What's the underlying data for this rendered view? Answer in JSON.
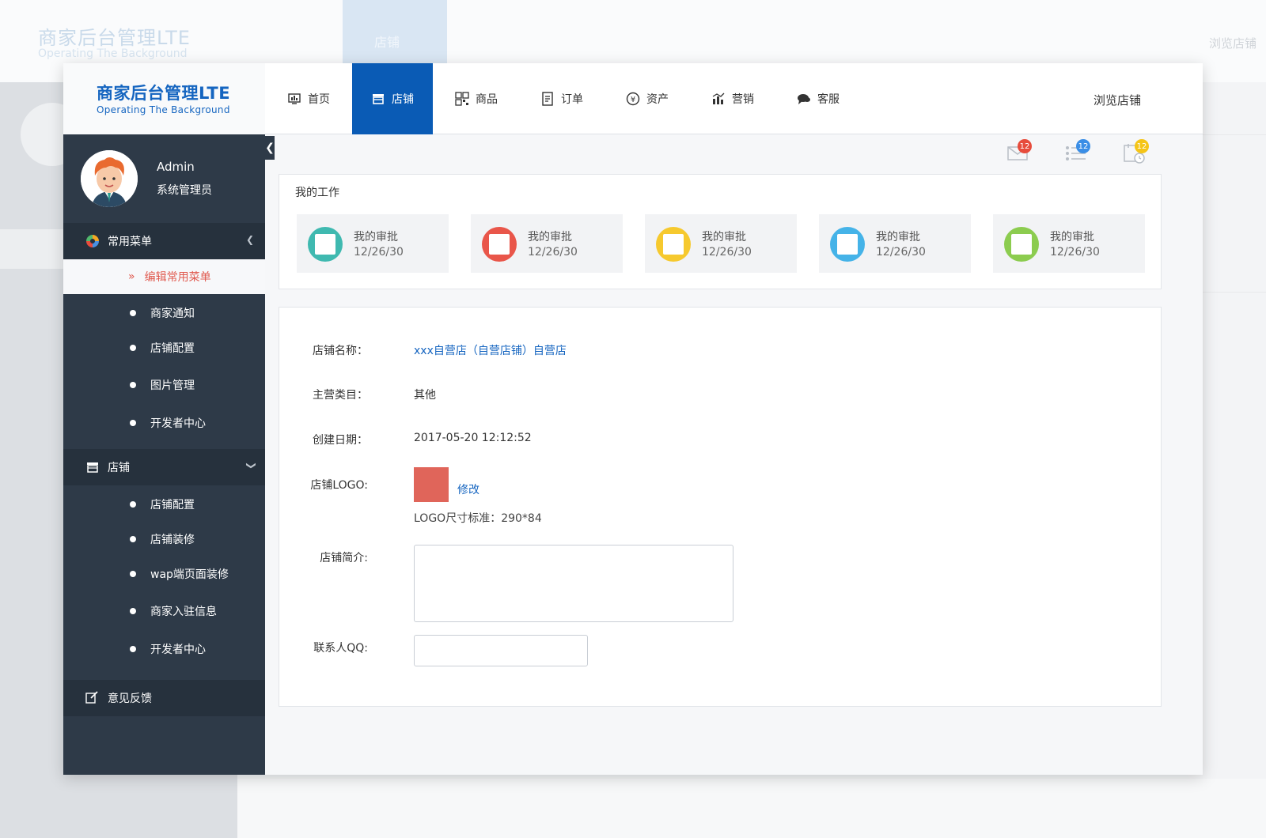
{
  "app": {
    "title": "商家后台管理LTE",
    "subtitle": "Operating The Background"
  },
  "nav": {
    "items": [
      {
        "label": "首页",
        "icon": "dashboard-icon"
      },
      {
        "label": "店铺",
        "icon": "store-icon",
        "active": true
      },
      {
        "label": "商品",
        "icon": "grid-icon"
      },
      {
        "label": "订单",
        "icon": "document-icon"
      },
      {
        "label": "资产",
        "icon": "yen-icon"
      },
      {
        "label": "营销",
        "icon": "bar-chart-icon"
      },
      {
        "label": "客服",
        "icon": "chat-icon"
      }
    ],
    "browse_label": "浏览店铺"
  },
  "user": {
    "name": "Admin",
    "role": "系统管理员"
  },
  "sidebar": {
    "common_menu": {
      "label": "常用菜单",
      "edit_label": "编辑常用菜单",
      "items": [
        "商家通知",
        "店铺配置",
        "图片管理",
        "开发者中心"
      ]
    },
    "store_menu": {
      "label": "店铺",
      "items": [
        "店铺配置",
        "店铺装修",
        "wap端页面装修",
        "商家入驻信息",
        "开发者中心"
      ]
    },
    "feedback_label": "意见反馈"
  },
  "notifications": [
    {
      "icon": "mail-icon",
      "count": "12",
      "color": "#e74c3c"
    },
    {
      "icon": "list-icon",
      "count": "12",
      "color": "#3a8ee6"
    },
    {
      "icon": "calendar-icon",
      "count": "12",
      "color": "#f5c518"
    }
  ],
  "work": {
    "title": "我的工作",
    "cards": [
      {
        "label": "我的审批",
        "date": "12/26/30",
        "color": "#3fb9b0"
      },
      {
        "label": "我的审批",
        "date": "12/26/30",
        "color": "#e9564a"
      },
      {
        "label": "我的审批",
        "date": "12/26/30",
        "color": "#f6c92e"
      },
      {
        "label": "我的审批",
        "date": "12/26/30",
        "color": "#45b3e8"
      },
      {
        "label": "我的审批",
        "date": "12/26/30",
        "color": "#8ccc4f"
      }
    ]
  },
  "form": {
    "store_name_label": "店铺名称：",
    "store_name_value": "xxx自营店（自营店铺）自营店",
    "category_label": "主营类目：",
    "category_value": "其他",
    "created_label": "创建日期：",
    "created_value": "2017-05-20 12:12:52",
    "logo_label": "店铺LOGO:",
    "logo_edit": "修改",
    "logo_hint": "LOGO尺寸标准：290*84",
    "intro_label": "店铺简介:",
    "intro_value": "",
    "qq_label": "联系人QQ:",
    "qq_value": ""
  }
}
